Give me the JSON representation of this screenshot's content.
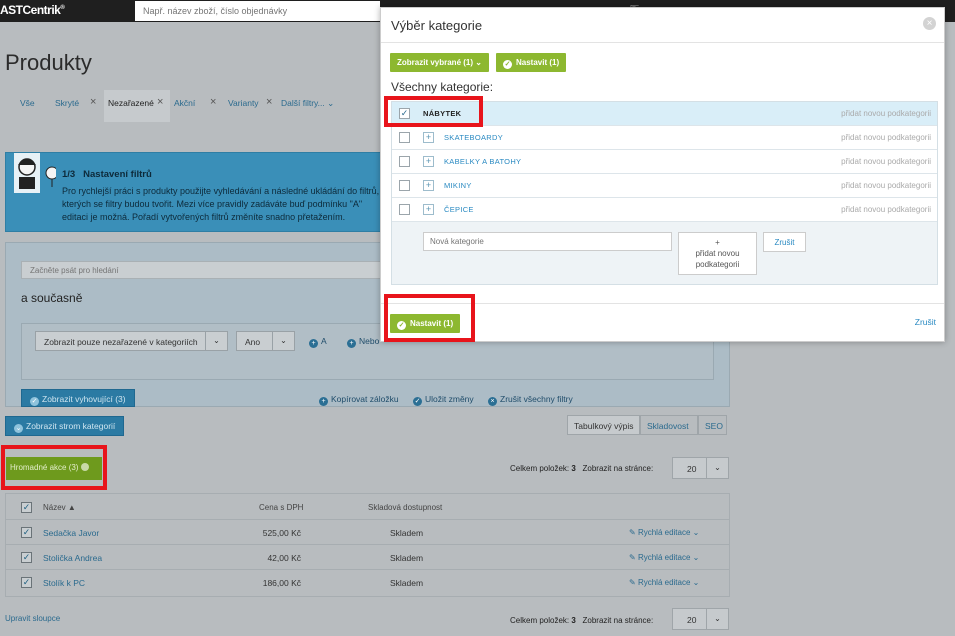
{
  "topbar": {
    "logo": "ASTCentrik",
    "logo_mark": "®",
    "search_placeholder": "Např. název zboží, číslo objednávky"
  },
  "page": {
    "title": "Produkty",
    "tabs": [
      {
        "label": "Vše"
      },
      {
        "label": "Skryté"
      },
      {
        "label": "Nezařazené"
      },
      {
        "label": "Akční"
      },
      {
        "label": "Varianty"
      },
      {
        "label": "Další filtry..."
      }
    ]
  },
  "info": {
    "step": "1/3",
    "title": "Nastavení filtrů",
    "text": "Pro rychlejší práci s produkty použijte vyhledávání a následné ukládání do filtrů, kterých se filtry budou tvořit. Mezi více pravidly zadáváte buď podmínku \"A\" editaci je možná. Pořadí vytvořených filtrů změníte snadno přetažením."
  },
  "filter": {
    "search_placeholder": "Začněte psát pro hledání",
    "subtitle": "a současně",
    "condition_select": "Zobrazit pouze nezařazené v kategoriích",
    "value_select": "Ano",
    "add_and": "A",
    "add_or": "Nebo",
    "show_matching": "Zobrazit vyhovující (3)",
    "copy_bookmark": "Kopírovat záložku",
    "save_changes": "Uložit změny",
    "cancel_all": "Zrušit všechny filtry"
  },
  "toolbar": {
    "show_tree": "Zobrazit strom kategorií",
    "views": [
      "Tabulkový výpis",
      "Skladovost",
      "SEO"
    ],
    "bulk_actions": "Hromadné akce (3)",
    "total_label": "Celkem položek:",
    "total_value": "3",
    "per_page_label": "Zobrazit na stránce:",
    "per_page_value": "20"
  },
  "table": {
    "columns": [
      "Název",
      "Cena s DPH",
      "Skladová dostupnost"
    ],
    "sort_mark": "▲",
    "rows": [
      {
        "name": "Sedačka Javor",
        "price": "525,00 Kč",
        "stock": "Skladem",
        "action": "Rychlá editace"
      },
      {
        "name": "Stolička Andrea",
        "price": "42,00 Kč",
        "stock": "Skladem",
        "action": "Rychlá editace"
      },
      {
        "name": "Stolík k PC",
        "price": "186,00 Kč",
        "stock": "Skladem",
        "action": "Rychlá editace"
      }
    ],
    "edit_columns": "Upravit sloupce"
  },
  "modal": {
    "title": "Výběr kategorie",
    "show_selected": "Zobrazit vybrané (1)",
    "set_label": "Nastavit (1)",
    "all_categories": "Všechny kategorie:",
    "categories": [
      {
        "name": "NÁBYTEK",
        "checked": true,
        "add": "přidat novou podkategorii"
      },
      {
        "name": "SKATEBOARDY",
        "checked": false,
        "add": "přidat novou podkategorii"
      },
      {
        "name": "KABELKY A BATOHY",
        "checked": false,
        "add": "přidat novou podkategorii"
      },
      {
        "name": "MIKINY",
        "checked": false,
        "add": "přidat novou podkategorii"
      },
      {
        "name": "ČEPICE",
        "checked": false,
        "add": "přidat novou podkategorii"
      }
    ],
    "new_category_placeholder": "Nová kategorie",
    "add_subcategory_plus": "+",
    "add_subcategory": "přidat novou podkategorii",
    "cancel": "Zrušit",
    "footer_cancel": "Zrušit"
  },
  "colors": {
    "accent_green": "#8db830",
    "link_blue": "#2a8ac2",
    "highlight_red": "#e8141b"
  }
}
